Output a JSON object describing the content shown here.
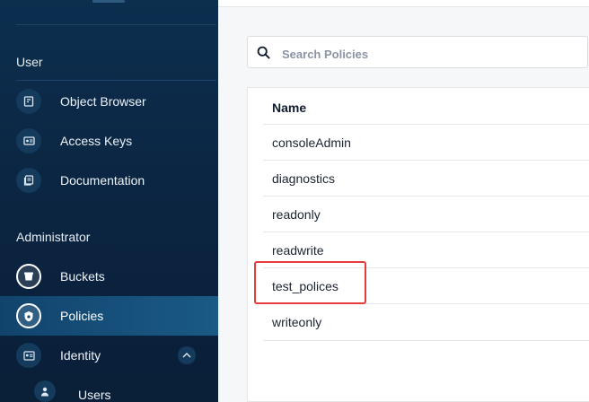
{
  "sidebar": {
    "sections": {
      "user_title": "User",
      "admin_title": "Administrator"
    },
    "user_items": [
      {
        "label": "Object Browser",
        "icon": "object-browser-icon"
      },
      {
        "label": "Access Keys",
        "icon": "access-keys-icon"
      },
      {
        "label": "Documentation",
        "icon": "documentation-icon"
      }
    ],
    "admin_items": [
      {
        "label": "Buckets",
        "icon": "bucket-icon"
      },
      {
        "label": "Policies",
        "icon": "shield-icon",
        "active": true
      },
      {
        "label": "Identity",
        "icon": "identity-card-icon"
      },
      {
        "label": "Users",
        "icon": "user-icon"
      }
    ]
  },
  "search": {
    "placeholder": "Search Policies",
    "value": ""
  },
  "table": {
    "header": "Name",
    "rows": [
      "consoleAdmin",
      "diagnostics",
      "readonly",
      "readwrite",
      "test_polices",
      "writeonly"
    ]
  },
  "colors": {
    "sidebar_bg": "#0b2440",
    "active_bg": "#1a5a85",
    "highlight": "#e63b3b"
  }
}
